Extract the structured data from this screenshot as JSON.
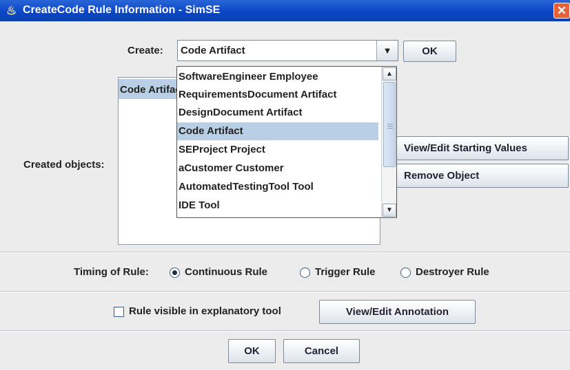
{
  "window": {
    "title": "CreateCode Rule Information - SimSE",
    "app_icon": "java-cup-icon",
    "close_glyph": "✕"
  },
  "create": {
    "label": "Create:",
    "selected": "Code Artifact",
    "ok_label": "OK",
    "options": [
      "SoftwareEngineer Employee",
      "RequirementsDocument Artifact",
      "DesignDocument Artifact",
      "Code Artifact",
      "SEProject Project",
      "aCustomer Customer",
      "AutomatedTestingTool Tool",
      "IDE Tool"
    ],
    "highlighted_index": 3
  },
  "created_objects": {
    "label": "Created objects:",
    "items": [
      "Code Artifact"
    ],
    "view_edit_label": "View/Edit Starting Values",
    "remove_label": "Remove Object"
  },
  "timing": {
    "label": "Timing of Rule:",
    "options": [
      "Continuous Rule",
      "Trigger Rule",
      "Destroyer Rule"
    ],
    "selected": "Continuous Rule"
  },
  "explanatory": {
    "checkbox_label": "Rule visible in explanatory tool",
    "checked": false,
    "annotation_label": "View/Edit Annotation"
  },
  "footer": {
    "ok_label": "OK",
    "cancel_label": "Cancel"
  }
}
